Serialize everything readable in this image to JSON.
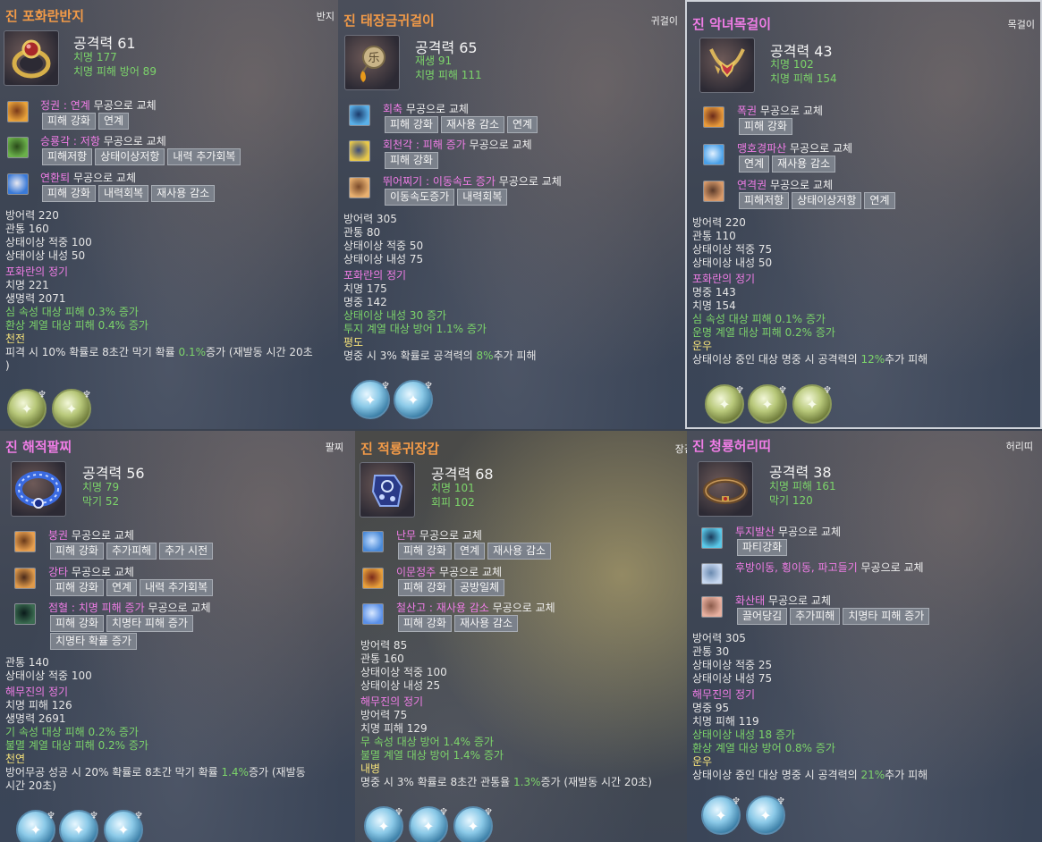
{
  "cards": [
    {
      "title": "진 포화란반지",
      "title_color": "#f19a48",
      "slot": "반지",
      "icon": "ring-icon",
      "attack": "공격력 61",
      "substats": [
        "치명 177",
        "치명 피해 방어 89"
      ],
      "skills": [
        {
          "icon": "fist-skill-icon",
          "name": "정권 : 연계",
          "replace": " 무공으로 교체",
          "chips": [
            "피해 강화",
            "연계"
          ]
        },
        {
          "icon": "kick-skill-icon",
          "name": "승룡각 : 저항",
          "replace": " 무공으로 교체",
          "chips": [
            "피해저항",
            "상태이상저항",
            "내력 추가회복"
          ]
        },
        {
          "icon": "combo-kick-skill-icon",
          "name": "연환퇴",
          "replace": " 무공으로 교체",
          "chips": [
            "피해 강화",
            "내력회복",
            "재사용 감소"
          ]
        }
      ],
      "base_stats": [
        "방어력 220",
        "관통 160",
        "상태이상 적중 100",
        "상태이상 내성 50"
      ],
      "essence_title": "포화란의 정기",
      "essence_stats": [
        "치명 221",
        "생명력 2071"
      ],
      "bonus": [
        "심 속성 대상 피해 0.3% 증가",
        "환상 계열 대상 피해 0.4% 증가"
      ],
      "set_name": "천전",
      "set_desc_pre": "피격 시 10% 확률로 8초간 막기 확률 ",
      "set_desc_hi": "0.1%",
      "set_desc_post": "증가 (재발동 시간 20초",
      "set_desc_line2": ")",
      "gems": [
        "g",
        "g"
      ]
    },
    {
      "title": "진 태장금귀걸이",
      "title_color": "#f19a48",
      "slot": "귀걸이",
      "icon": "earring-icon",
      "attack": "공격력 65",
      "substats": [
        "재생 91",
        "치명 피해 111"
      ],
      "skills": [
        {
          "icon": "crescent-skill-icon",
          "name": "회축",
          "replace": " 무공으로 교체",
          "chips": [
            "피해 강화",
            "재사용 감소",
            "연계"
          ]
        },
        {
          "icon": "spin-kick-skill-icon",
          "name": "회천각 : 피해 증가",
          "replace": " 무공으로 교체",
          "chips": [
            "피해 강화"
          ]
        },
        {
          "icon": "leap-skill-icon",
          "name": "뛰어찌기 : 이동속도 증가",
          "replace": " 무공으로 교체",
          "chips": [
            "이동속도증가",
            "내력회복"
          ]
        }
      ],
      "base_stats": [
        "방어력 305",
        "관통 80",
        "상태이상 적중 50",
        "상태이상 내성 75"
      ],
      "essence_title": "포화란의 정기",
      "essence_stats": [
        "치명 175",
        "명중 142"
      ],
      "bonus": [
        "상태이상 내성 30 증가",
        "투지 계열 대상 방어 1.1% 증가"
      ],
      "set_name": "평도",
      "set_desc_pre": "명중 시 3% 확률로 공격력의 ",
      "set_desc_hi": "8%",
      "set_desc_post": "추가 피해",
      "set_desc_line2": "",
      "gems": [
        "b",
        "b"
      ]
    },
    {
      "title": "진 악녀목걸이",
      "title_color": "#f07de6",
      "slot": "목걸이",
      "icon": "necklace-icon",
      "attack": "공격력 43",
      "substats": [
        "치명 102",
        "치명 피해 154"
      ],
      "skills": [
        {
          "icon": "burst-fist-skill-icon",
          "name": "폭권",
          "replace": " 무공으로 교체",
          "chips": [
            "피해 강화"
          ]
        },
        {
          "icon": "tiger-palm-skill-icon",
          "name": "맹호경파산",
          "replace": " 무공으로 교체",
          "chips": [
            "연계",
            "재사용 감소"
          ]
        },
        {
          "icon": "chain-fist-skill-icon",
          "name": "연격권",
          "replace": " 무공으로 교체",
          "chips": [
            "피해저항",
            "상태이상저항",
            "연계"
          ]
        }
      ],
      "base_stats": [
        "방어력 220",
        "관통 110",
        "상태이상 적중 75",
        "상태이상 내성 50"
      ],
      "essence_title": "포화란의 정기",
      "essence_stats": [
        "명중 143",
        "치명 154"
      ],
      "bonus": [
        "심 속성 대상 피해 0.1% 증가",
        "운명 계열 대상 피해 0.2% 증가"
      ],
      "set_name": "운우",
      "set_desc_pre": "상태이상 중인 대상 명중 시 공격력의 ",
      "set_desc_hi": "12%",
      "set_desc_post": "추가 피해",
      "set_desc_line2": "",
      "gems": [
        "g",
        "g",
        "g"
      ]
    },
    {
      "title": "진 해적팔찌",
      "title_color": "#f07de6",
      "slot": "팔찌",
      "icon": "bracelet-icon",
      "attack": "공격력 56",
      "substats": [
        "치명 79",
        "막기 52"
      ],
      "skills": [
        {
          "icon": "collapse-fist-skill-icon",
          "name": "붕권",
          "replace": " 무공으로 교체",
          "chips": [
            "피해 강화",
            "추가피해",
            "추가 시전"
          ]
        },
        {
          "icon": "strong-hit-skill-icon",
          "name": "강타",
          "replace": " 무공으로 교체",
          "chips": [
            "피해 강화",
            "연계",
            "내력 추가회복"
          ]
        },
        {
          "icon": "pressure-point-skill-icon",
          "name": "점혈 : 치명 피해 증가",
          "replace": " 무공으로 교체",
          "chips": [
            "피해 강화",
            "치명타 피해 증가"
          ],
          "chips2": [
            "치명타 확률 증가"
          ]
        }
      ],
      "base_stats": [
        "관통 140",
        "상태이상 적중 100"
      ],
      "essence_title": "해무진의 정기",
      "essence_stats": [
        "치명 피해 126",
        "생명력 2691"
      ],
      "bonus": [
        "기 속성 대상 피해 0.2% 증가",
        "불멸 계열 대상 피해 0.2% 증가"
      ],
      "set_name": "천연",
      "set_desc_pre": "방어무공 성공 시 20% 확률로 8초간 막기 확률 ",
      "set_desc_hi": "1.4%",
      "set_desc_post": "증가 (재발동",
      "set_desc_line2": "시간 20초)",
      "gems": [
        "b",
        "b",
        "b"
      ]
    },
    {
      "title": "진 적룡귀장갑",
      "title_color": "#f19a48",
      "slot": "장갑",
      "icon": "gauntlet-icon",
      "attack": "공격력 68",
      "substats": [
        "치명 101",
        "회피 102"
      ],
      "skills": [
        {
          "icon": "dance-skill-icon",
          "name": "난무",
          "replace": " 무공으로 교체",
          "chips": [
            "피해 강화",
            "연계",
            "재사용 감소"
          ]
        },
        {
          "icon": "thrust-skill-icon",
          "name": "이문정주",
          "replace": " 무공으로 교체",
          "chips": [
            "피해 강화",
            "공방일체"
          ]
        },
        {
          "icon": "iron-mountain-skill-icon",
          "name": "철산고 : 재사용 감소",
          "replace": " 무공으로 교체",
          "chips": [
            "피해 강화",
            "재사용 감소"
          ]
        }
      ],
      "base_stats": [
        "방어력 85",
        "관통 160",
        "상태이상 적중 100",
        "상태이상 내성 25"
      ],
      "essence_title": "해무진의 정기",
      "essence_stats": [
        "방어력 75",
        "치명 피해 129"
      ],
      "bonus": [
        "무 속성 대상 방어 1.4% 증가",
        "불멸 계열 대상 방어 1.4% 증가"
      ],
      "set_name": "내병",
      "set_desc_pre": "명중 시 3% 확률로 8초간 관통율 ",
      "set_desc_hi": "1.3%",
      "set_desc_post": "증가 (재발동 시간 20초)",
      "set_desc_line2": "",
      "gems": [
        "b",
        "b",
        "b"
      ]
    },
    {
      "title": "진 청룡허리띠",
      "title_color": "#f07de6",
      "slot": "허리띠",
      "icon": "belt-icon",
      "attack": "공격력 38",
      "substats": [
        "치명 피해 161",
        "막기 120"
      ],
      "skills": [
        {
          "icon": "fighting-spirit-skill-icon",
          "name": "투지발산",
          "replace": " 무공으로 교체",
          "chips": [
            "파티강화"
          ]
        },
        {
          "icon": "dodge-skill-icon",
          "name": "후방이동, 횡이동, 파고들기",
          "replace": " 무공으로 교체",
          "chips": []
        },
        {
          "icon": "fire-mountain-skill-icon",
          "name": "화산태",
          "replace": " 무공으로 교체",
          "chips": [
            "끌어당김",
            "추가피해",
            "치명타 피해 증가"
          ]
        }
      ],
      "base_stats": [
        "방어력 305",
        "관통 30",
        "상태이상 적중 25",
        "상태이상 내성 75"
      ],
      "essence_title": "해무진의 정기",
      "essence_stats": [
        "명중 95",
        "치명 피해 119"
      ],
      "bonus": [
        "상태이상 내성 18 증가",
        "환상 계열 대상 방어 0.8% 증가"
      ],
      "set_name": "운우",
      "set_desc_pre": "상태이상 중인 대상 명중 시 공격력의 ",
      "set_desc_hi": "21%",
      "set_desc_post": "추가 피해",
      "set_desc_line2": "",
      "gems": [
        "b",
        "b"
      ]
    }
  ]
}
